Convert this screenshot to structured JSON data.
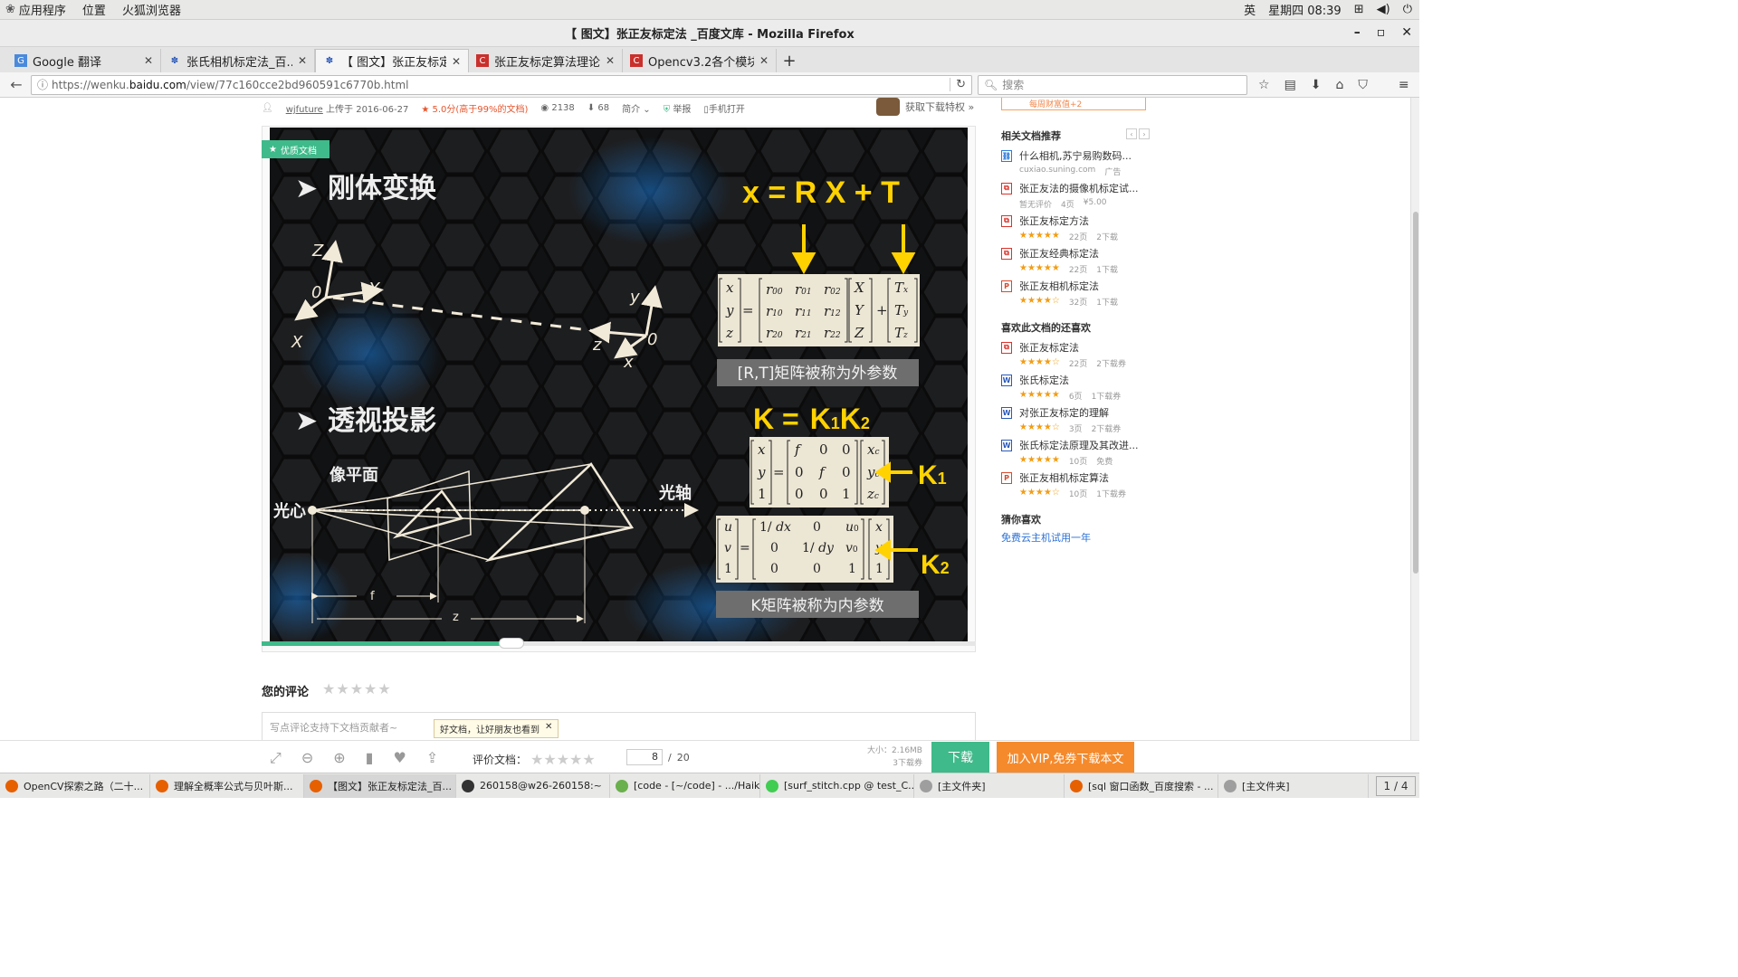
{
  "system_bar": {
    "apps": "应用程序",
    "places": "位置",
    "browser": "火狐浏览器",
    "ime": "英",
    "clock": "星期四 08:39"
  },
  "window": {
    "title": "【 图文】张正友标定法 _百度文库 - Mozilla Firefox"
  },
  "tabs": [
    {
      "label": "Google 翻译",
      "active": false
    },
    {
      "label": "张氏相机标定法_百...",
      "active": false
    },
    {
      "label": "【 图文】张正友标定...",
      "active": true
    },
    {
      "label": "张正友标定算法理论...",
      "active": false
    },
    {
      "label": "Opencv3.2各个模块...",
      "active": false
    }
  ],
  "navbar": {
    "url_prefix": "https://wenku.",
    "url_host": "baidu.com",
    "url_path": "/view/77c160cce2bd960591c6770b.html",
    "search_placeholder": "搜索"
  },
  "doc_meta": {
    "user": "wjfuture",
    "uploaded": "上传于",
    "date": "2016-06-27",
    "rating": "5.0分(高于99%的文档)",
    "views": "2138",
    "downloads": "68",
    "intro": "简介",
    "report": "举报",
    "mobile": "手机打开",
    "get_privilege": "获取下载特权 »"
  },
  "slide": {
    "badge": "优质文档",
    "heading1": "刚体变换",
    "heading2": "透视投影",
    "eq1": "x = R X + T",
    "eq2_k": "K =",
    "eq2_k1": "K",
    "eq2_k1_sub": "1",
    "eq2_k2": "K",
    "eq2_k2_sub": "2",
    "caption1": "[R,T]矩阵被称为外参数",
    "caption2": "K矩阵被称为内参数",
    "label_image_plane": "像平面",
    "label_optical_center": "光心",
    "label_optical_axis": "光轴",
    "label_f": "f",
    "label_z": "z",
    "k1_label": "K",
    "k1_sub": "1",
    "k2_label": "K",
    "k2_sub": "2",
    "axis_Z": "Z",
    "axis_Y": "Y",
    "axis_X": "X",
    "axis_0": "0",
    "axis_y": "y",
    "axis_z": "z",
    "axis_x": "x",
    "axis_0b": "0"
  },
  "comment": {
    "title": "您的评论",
    "stars": "★★★★★",
    "placeholder": "写点评论支持下文档贡献者~",
    "tooltip": "好文档，让好朋友也看到"
  },
  "sidebar": {
    "top_note": "每周财富值+2",
    "related_title": "相关文档推荐",
    "related": [
      {
        "icon": "link",
        "title": "什么相机,苏宁易购数码...",
        "meta1": "cuxiao.suning.com",
        "meta2": "广告",
        "meta3": ""
      },
      {
        "icon": "pdf",
        "title": "张正友法的摄像机标定试...",
        "meta1": "暂无评价",
        "meta2": "4页",
        "meta3": "¥5.00"
      },
      {
        "icon": "pdf",
        "title": "张正友标定方法",
        "meta1": "★★★★★",
        "meta2": "22页",
        "meta3": "2下载"
      },
      {
        "icon": "pdf",
        "title": "张正友经典标定法",
        "meta1": "★★★★★",
        "meta2": "22页",
        "meta3": "1下载"
      },
      {
        "icon": "ppt",
        "title": "张正友相机标定法",
        "meta1": "★★★★☆",
        "meta2": "32页",
        "meta3": "1下载"
      }
    ],
    "also_like_title": "喜欢此文档的还喜欢",
    "also_like": [
      {
        "icon": "pdf",
        "title": "张正友标定法",
        "meta1": "★★★★☆",
        "meta2": "22页",
        "meta3": "2下载券"
      },
      {
        "icon": "word",
        "title": "张氏标定法",
        "meta1": "★★★★★",
        "meta2": "6页",
        "meta3": "1下载券"
      },
      {
        "icon": "word",
        "title": "对张正友标定的理解",
        "meta1": "★★★★☆",
        "meta2": "3页",
        "meta3": "2下载券"
      },
      {
        "icon": "word",
        "title": "张氏标定法原理及其改进...",
        "meta1": "★★★★★",
        "meta2": "10页",
        "meta3": "免费"
      },
      {
        "icon": "ppt",
        "title": "张正友相机标定算法",
        "meta1": "★★★★☆",
        "meta2": "10页",
        "meta3": "1下载券"
      }
    ],
    "guess_title": "猜你喜欢",
    "guess_link": "免费云主机试用一年"
  },
  "doc_toolbar": {
    "rate_label": "评价文档：",
    "stars": "★★★★★",
    "current_page": "8",
    "total_pages": "20",
    "size": "大小：2.16MB",
    "cost": "3下载券",
    "download": "下载",
    "vip": "加入VIP,免券下载本文",
    "progress": 0.35
  },
  "taskbar": [
    {
      "label": "OpenCV探索之路（二十...",
      "color": "#e66000",
      "active": false
    },
    {
      "label": "理解全概率公式与贝叶斯...",
      "color": "#e66000",
      "active": false
    },
    {
      "label": "【图文】张正友标定法_百...",
      "color": "#e66000",
      "active": true
    },
    {
      "label": "260158@w26-260158:~",
      "color": "#333333",
      "active": false
    },
    {
      "label": "[code - [~/code] - .../Haik...",
      "color": "#6ab04c",
      "active": false
    },
    {
      "label": "[surf_stitch.cpp @ test_C...",
      "color": "#41cd52",
      "active": false
    },
    {
      "label": "[主文件夹]",
      "color": "#9e9e9e",
      "active": false
    },
    {
      "label": "[sql 窗口函数_百度搜索 - ...",
      "color": "#e66000",
      "active": false
    },
    {
      "label": "[主文件夹]",
      "color": "#9e9e9e",
      "active": false
    }
  ],
  "workspace": "1 / 4"
}
